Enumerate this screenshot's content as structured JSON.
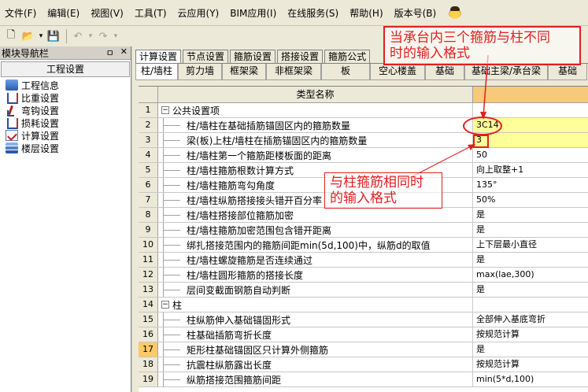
{
  "menu": [
    {
      "label": "文件(F)"
    },
    {
      "label": "编辑(E)"
    },
    {
      "label": "视图(V)"
    },
    {
      "label": "工具(T)"
    },
    {
      "label": "云应用(Y)"
    },
    {
      "label": "BIM应用(I)"
    },
    {
      "label": "在线服务(S)"
    },
    {
      "label": "帮助(H)"
    },
    {
      "label": "版本号(B)"
    }
  ],
  "nav": {
    "title": "模块导航栏",
    "pin": "ㅁ",
    "close": "✕",
    "section": "工程设置",
    "items": [
      {
        "label": "工程信息",
        "icon": "doc"
      },
      {
        "label": "比重设置",
        "icon": "w"
      },
      {
        "label": "弯钩设置",
        "icon": "hook"
      },
      {
        "label": "损耗设置",
        "icon": "w"
      },
      {
        "label": "计算设置",
        "icon": "calc"
      },
      {
        "label": "楼层设置",
        "icon": "layer"
      }
    ]
  },
  "tabs_primary": [
    {
      "label": "计算设置",
      "active": true
    },
    {
      "label": "节点设置"
    },
    {
      "label": "箍筋设置"
    },
    {
      "label": "搭接设置"
    },
    {
      "label": "箍筋公式"
    }
  ],
  "tabs_secondary": [
    {
      "label": "柱/墙柱",
      "active": true
    },
    {
      "label": "剪力墙"
    },
    {
      "label": "框架梁"
    },
    {
      "label": "非框架梁"
    },
    {
      "label": "板"
    },
    {
      "label": "空心楼盖"
    },
    {
      "label": "基础"
    },
    {
      "label": "基础主梁/承台梁"
    },
    {
      "label": "基础"
    }
  ],
  "table": {
    "header": "类型名称",
    "rows": [
      {
        "num": "1",
        "group": true,
        "name": "公共设置项",
        "toggle": "−"
      },
      {
        "num": "2",
        "name": "柱/墙柱在基础插筋锚固区内的箍筋数量",
        "value": "3C14",
        "highlight": true
      },
      {
        "num": "3",
        "name": "梁(板)上柱/墙柱在插筋锚固区内的箍筋数量",
        "value": "3",
        "highlight": true
      },
      {
        "num": "4",
        "name": "柱/墙柱第一个箍筋距楼板面的距离",
        "value": "50"
      },
      {
        "num": "5",
        "name": "柱/墙柱箍筋根数计算方式",
        "value": "向上取整+1"
      },
      {
        "num": "6",
        "name": "柱/墙柱箍筋弯勾角度",
        "value": "135°"
      },
      {
        "num": "7",
        "name": "柱/墙柱纵筋搭接接头错开百分率",
        "value": "50%"
      },
      {
        "num": "8",
        "name": "柱/墙柱搭接部位箍筋加密",
        "value": "是"
      },
      {
        "num": "9",
        "name": "柱/墙柱箍筋加密范围包含错开距离",
        "value": "是"
      },
      {
        "num": "10",
        "name": "绑扎搭接范围内的箍筋间距min(5d,100)中，纵筋d的取值",
        "value": "上下层最小直径"
      },
      {
        "num": "11",
        "name": "柱/墙柱螺旋箍筋是否连续通过",
        "value": "是"
      },
      {
        "num": "12",
        "name": "柱/墙柱圆形箍筋的搭接长度",
        "value": "max(lae,300)"
      },
      {
        "num": "13",
        "name": "层间变截面钢筋自动判断",
        "value": "是"
      },
      {
        "num": "14",
        "group": true,
        "name": "柱",
        "toggle": "−"
      },
      {
        "num": "15",
        "name": "柱纵筋伸入基础锚固形式",
        "value": "全部伸入基底弯折"
      },
      {
        "num": "16",
        "name": "柱基础插筋弯折长度",
        "value": "按规范计算"
      },
      {
        "num": "17",
        "name": "矩形柱基础锚固区只计算外侧箍筋",
        "value": "是",
        "selected": true
      },
      {
        "num": "18",
        "name": "抗震柱纵筋露出长度",
        "value": "按规范计算"
      },
      {
        "num": "19",
        "name": "纵筋搭接范围箍筋间距",
        "value": "min(5*d,100)"
      }
    ]
  },
  "annotations": {
    "top": [
      "当承台内三个箍筋与柱不同",
      "时的输入格式"
    ],
    "middle": [
      "与柱箍筋相同时",
      "的输入格式"
    ],
    "color": "#e02020"
  }
}
